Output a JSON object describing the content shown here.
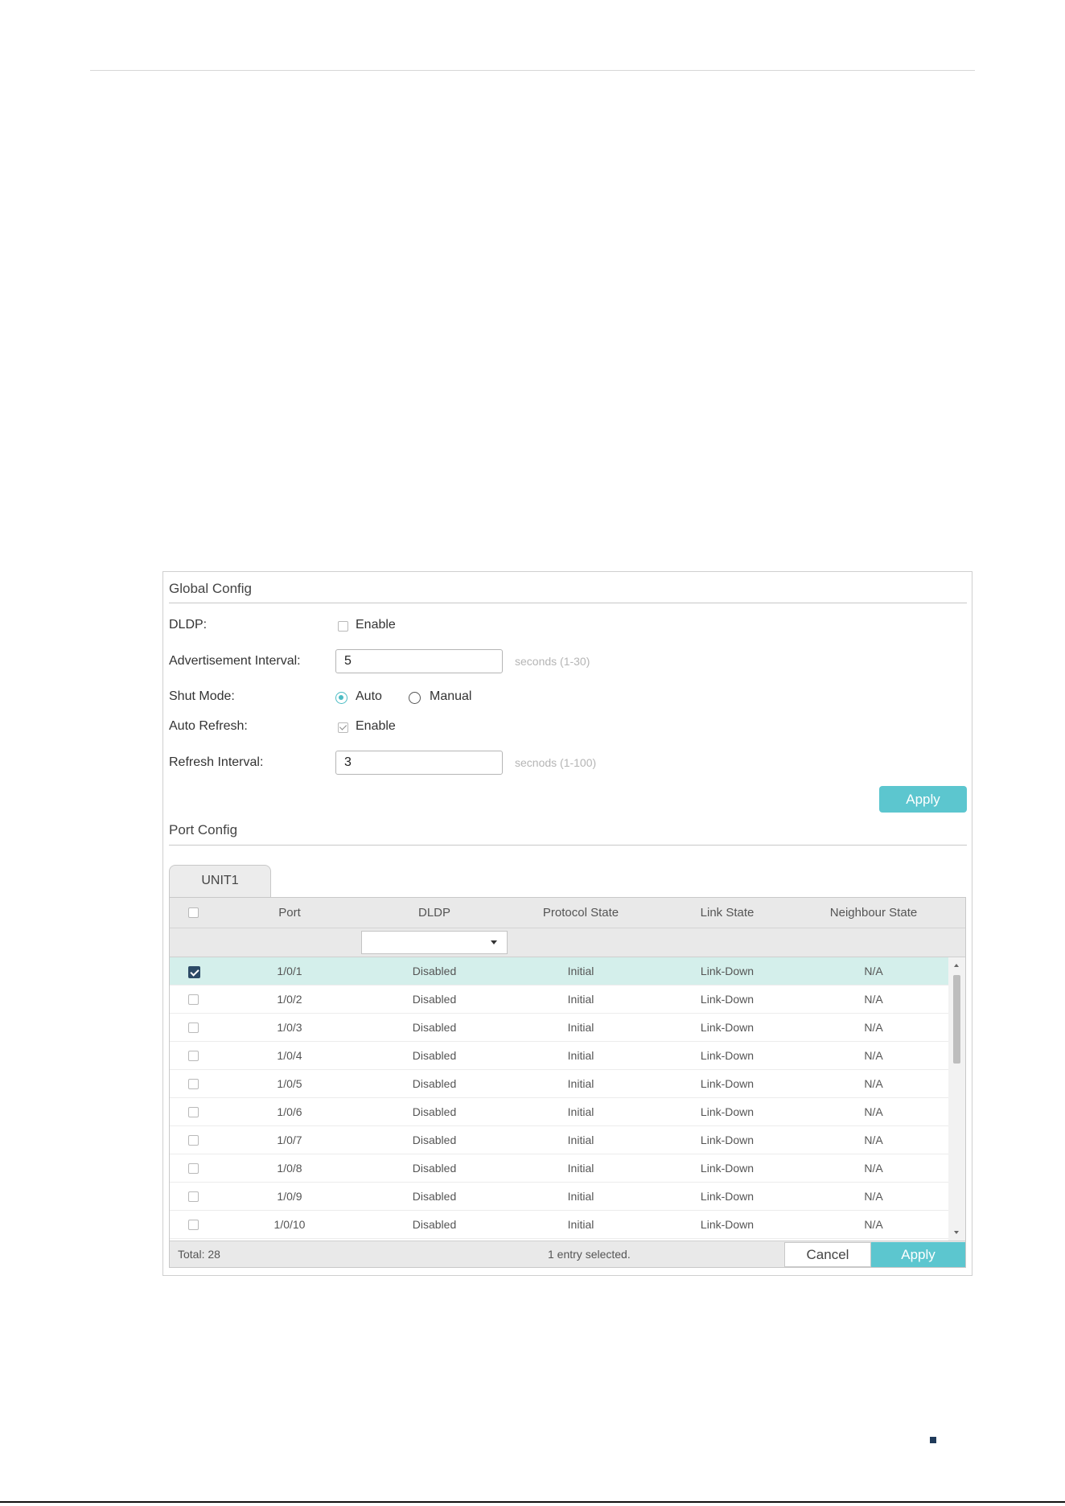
{
  "global_config": {
    "title": "Global Config",
    "dldp_label": "DLDP:",
    "dldp_enable_label": "Enable",
    "dldp_enabled": false,
    "adv_interval_label": "Advertisement Interval:",
    "adv_interval_value": "5",
    "adv_interval_hint": "seconds (1-30)",
    "shut_mode_label": "Shut Mode:",
    "shut_mode_options": [
      "Auto",
      "Manual"
    ],
    "shut_mode_selected": "Auto",
    "auto_refresh_label": "Auto Refresh:",
    "auto_refresh_enable_label": "Enable",
    "auto_refresh_enabled": true,
    "refresh_interval_label": "Refresh Interval:",
    "refresh_interval_value": "3",
    "refresh_interval_hint": "secnods (1-100)",
    "apply_label": "Apply"
  },
  "port_config": {
    "title": "Port Config",
    "tab_label": "UNIT1",
    "columns": [
      "Port",
      "DLDP",
      "Protocol State",
      "Link State",
      "Neighbour State"
    ],
    "dldp_filter_value": "",
    "rows": [
      {
        "port": "1/0/1",
        "dldp": "Disabled",
        "protocol_state": "Initial",
        "link_state": "Link-Down",
        "neighbour_state": "N/A",
        "selected": true
      },
      {
        "port": "1/0/2",
        "dldp": "Disabled",
        "protocol_state": "Initial",
        "link_state": "Link-Down",
        "neighbour_state": "N/A",
        "selected": false
      },
      {
        "port": "1/0/3",
        "dldp": "Disabled",
        "protocol_state": "Initial",
        "link_state": "Link-Down",
        "neighbour_state": "N/A",
        "selected": false
      },
      {
        "port": "1/0/4",
        "dldp": "Disabled",
        "protocol_state": "Initial",
        "link_state": "Link-Down",
        "neighbour_state": "N/A",
        "selected": false
      },
      {
        "port": "1/0/5",
        "dldp": "Disabled",
        "protocol_state": "Initial",
        "link_state": "Link-Down",
        "neighbour_state": "N/A",
        "selected": false
      },
      {
        "port": "1/0/6",
        "dldp": "Disabled",
        "protocol_state": "Initial",
        "link_state": "Link-Down",
        "neighbour_state": "N/A",
        "selected": false
      },
      {
        "port": "1/0/7",
        "dldp": "Disabled",
        "protocol_state": "Initial",
        "link_state": "Link-Down",
        "neighbour_state": "N/A",
        "selected": false
      },
      {
        "port": "1/0/8",
        "dldp": "Disabled",
        "protocol_state": "Initial",
        "link_state": "Link-Down",
        "neighbour_state": "N/A",
        "selected": false
      },
      {
        "port": "1/0/9",
        "dldp": "Disabled",
        "protocol_state": "Initial",
        "link_state": "Link-Down",
        "neighbour_state": "N/A",
        "selected": false
      },
      {
        "port": "1/0/10",
        "dldp": "Disabled",
        "protocol_state": "Initial",
        "link_state": "Link-Down",
        "neighbour_state": "N/A",
        "selected": false
      }
    ],
    "total_text": "Total: 28",
    "selection_text": "1 entry selected.",
    "cancel_label": "Cancel",
    "apply_label": "Apply"
  },
  "colors": {
    "accent": "#5cc6cf",
    "selected_row": "#d4efeb",
    "checked_box": "#2c4a66"
  }
}
